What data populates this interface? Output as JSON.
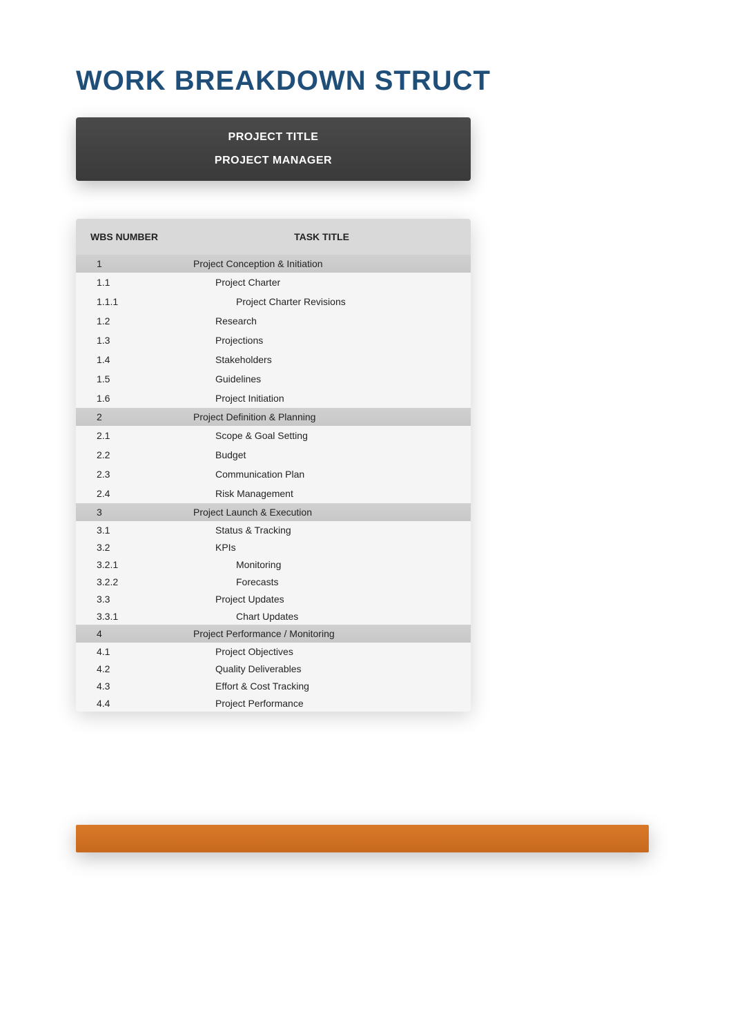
{
  "page_title": "WORK BREAKDOWN STRUCT",
  "header": {
    "project_title_label": "PROJECT TITLE",
    "project_manager_label": "PROJECT MANAGER"
  },
  "table": {
    "columns": {
      "wbs": "WBS NUMBER",
      "title": "TASK TITLE"
    },
    "rows": [
      {
        "wbs": "1",
        "title": "Project Conception & Initiation",
        "indent": 0,
        "section": true,
        "size": "normal"
      },
      {
        "wbs": "1.1",
        "title": "Project Charter",
        "indent": 1,
        "section": false,
        "size": "normal"
      },
      {
        "wbs": "1.1.1",
        "title": "Project Charter Revisions",
        "indent": 2,
        "section": false,
        "size": "normal"
      },
      {
        "wbs": "1.2",
        "title": "Research",
        "indent": 1,
        "section": false,
        "size": "normal"
      },
      {
        "wbs": "1.3",
        "title": "Projections",
        "indent": 1,
        "section": false,
        "size": "normal"
      },
      {
        "wbs": "1.4",
        "title": "Stakeholders",
        "indent": 1,
        "section": false,
        "size": "normal"
      },
      {
        "wbs": "1.5",
        "title": "Guidelines",
        "indent": 1,
        "section": false,
        "size": "normal"
      },
      {
        "wbs": "1.6",
        "title": "Project Initiation",
        "indent": 1,
        "section": false,
        "size": "normal"
      },
      {
        "wbs": "2",
        "title": "Project Definition & Planning",
        "indent": 0,
        "section": true,
        "size": "normal"
      },
      {
        "wbs": "2.1",
        "title": "Scope & Goal Setting",
        "indent": 1,
        "section": false,
        "size": "normal"
      },
      {
        "wbs": "2.2",
        "title": "Budget",
        "indent": 1,
        "section": false,
        "size": "normal"
      },
      {
        "wbs": "2.3",
        "title": "Communication Plan",
        "indent": 1,
        "section": false,
        "size": "normal"
      },
      {
        "wbs": "2.4",
        "title": "Risk Management",
        "indent": 1,
        "section": false,
        "size": "normal"
      },
      {
        "wbs": "3",
        "title": "Project Launch & Execution",
        "indent": 0,
        "section": true,
        "size": "compact"
      },
      {
        "wbs": "3.1",
        "title": "Status & Tracking",
        "indent": 1,
        "section": false,
        "size": "compact"
      },
      {
        "wbs": "3.2",
        "title": "KPIs",
        "indent": 1,
        "section": false,
        "size": "compact"
      },
      {
        "wbs": "3.2.1",
        "title": "Monitoring",
        "indent": 2,
        "section": false,
        "size": "compact"
      },
      {
        "wbs": "3.2.2",
        "title": "Forecasts",
        "indent": 2,
        "section": false,
        "size": "compact"
      },
      {
        "wbs": "3.3",
        "title": "Project Updates",
        "indent": 1,
        "section": false,
        "size": "compact"
      },
      {
        "wbs": "3.3.1",
        "title": "Chart Updates",
        "indent": 2,
        "section": false,
        "size": "compact"
      },
      {
        "wbs": "4",
        "title": "Project Performance / Monitoring",
        "indent": 0,
        "section": true,
        "size": "compact"
      },
      {
        "wbs": "4.1",
        "title": "Project Objectives",
        "indent": 1,
        "section": false,
        "size": "compact"
      },
      {
        "wbs": "4.2",
        "title": "Quality Deliverables",
        "indent": 1,
        "section": false,
        "size": "compact"
      },
      {
        "wbs": "4.3",
        "title": "Effort & Cost Tracking",
        "indent": 1,
        "section": false,
        "size": "compact"
      },
      {
        "wbs": "4.4",
        "title": "Project Performance",
        "indent": 1,
        "section": false,
        "size": "compact"
      }
    ]
  },
  "colors": {
    "title": "#1f4e79",
    "header_bg": "#3f3f3f",
    "table_header_bg": "#d9d9d9",
    "section_bg": "#cccccc",
    "orange_bar": "#c76a1e"
  }
}
